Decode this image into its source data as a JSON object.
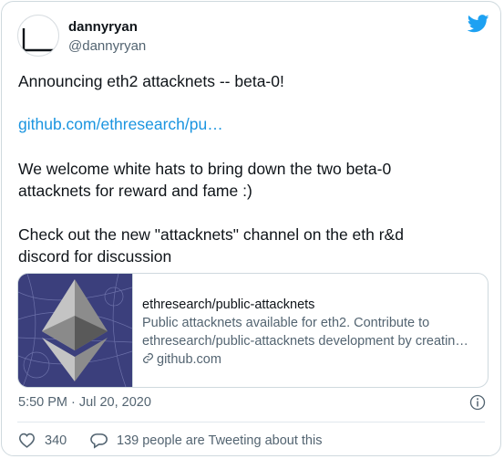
{
  "user": {
    "name": "dannyryan",
    "handle": "@dannyryan"
  },
  "tweet": {
    "line1": "Announcing eth2 attacknets -- beta-0!",
    "link": "github.com/ethresearch/pu…",
    "para2_line1": "We welcome white hats to bring down the two beta-0",
    "para2_line2": "attacknets for reward and fame :)",
    "para3_line1": "Check out the new \"attacknets\" channel on the eth r&d",
    "para3_line2": "discord for discussion"
  },
  "card": {
    "title": "ethresearch/public-attacknets",
    "desc_line1": "Public attacknets available for eth2. Contribute to",
    "desc_line2": "ethresearch/public-attacknets development by creatin…",
    "domain": "github.com"
  },
  "timestamp": "5:50 PM · Jul 20, 2020",
  "actions": {
    "likes": "340",
    "replies_text": "139 people are Tweeting about this"
  },
  "colors": {
    "accent": "#1b95e0",
    "secondary_text": "#536471",
    "border": "#cfd9de"
  }
}
